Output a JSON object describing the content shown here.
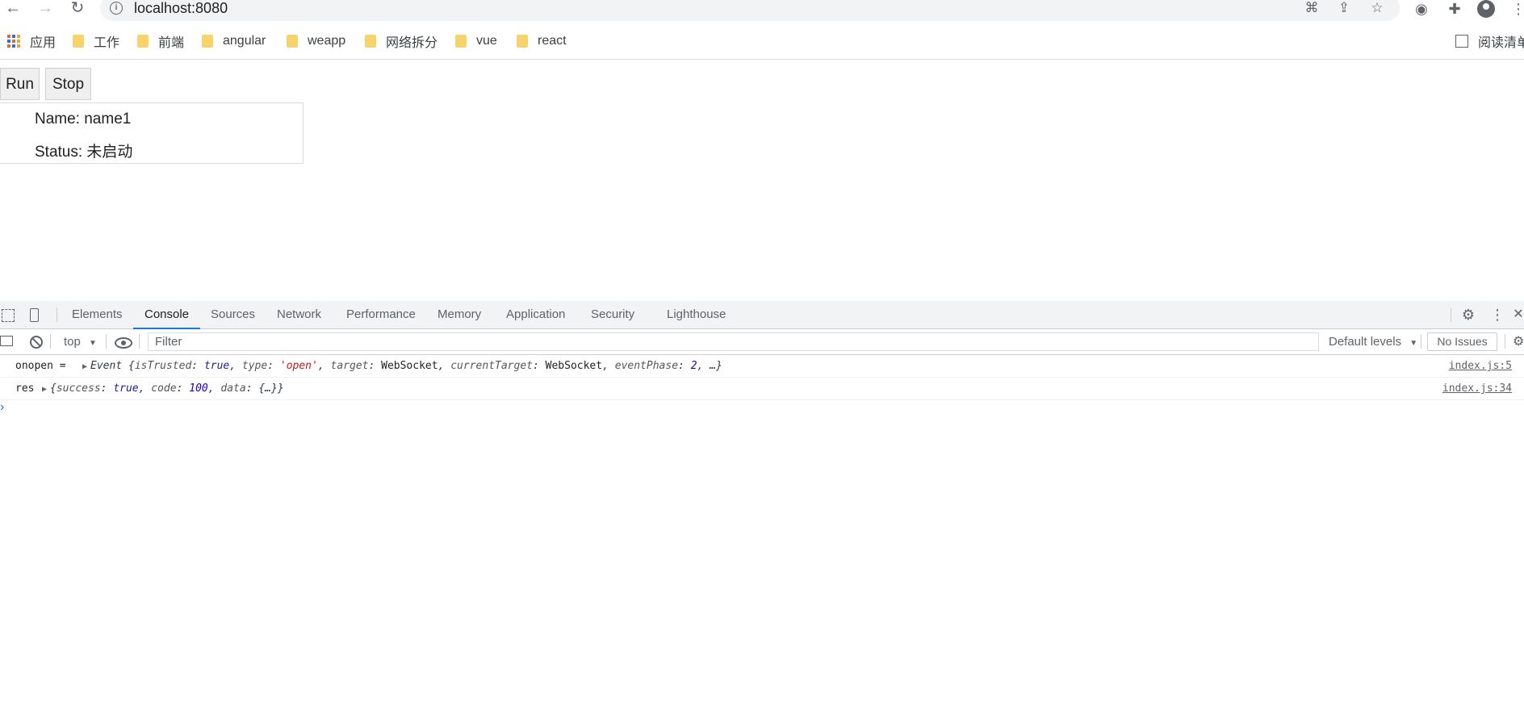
{
  "browser": {
    "url": "localhost:8080",
    "bookmarks": [
      {
        "label": "应用",
        "icon": "apps-icon"
      },
      {
        "label": "工作",
        "icon": "folder-icon"
      },
      {
        "label": "前端",
        "icon": "folder-icon"
      },
      {
        "label": "angular",
        "icon": "folder-icon"
      },
      {
        "label": "weapp",
        "icon": "folder-icon"
      },
      {
        "label": "网络拆分",
        "icon": "folder-icon"
      },
      {
        "label": "vue",
        "icon": "folder-icon"
      },
      {
        "label": "react",
        "icon": "folder-icon"
      }
    ],
    "reading_list": "阅读清单"
  },
  "page": {
    "run_label": "Run",
    "stop_label": "Stop",
    "name_line": "Name: name1",
    "status_line": "Status: 未启动"
  },
  "devtools": {
    "tabs": [
      "Elements",
      "Console",
      "Sources",
      "Network",
      "Performance",
      "Memory",
      "Application",
      "Security",
      "Lighthouse"
    ],
    "active_tab": "Console",
    "context": "top",
    "filter_placeholder": "Filter",
    "levels": "Default levels",
    "issues": "No Issues",
    "console": [
      {
        "label": "onopen =",
        "class_name": "Event",
        "entries": [
          {
            "key": "isTrusted",
            "value": "true",
            "type": "bool"
          },
          {
            "key": "type",
            "value": "'open'",
            "type": "string"
          },
          {
            "key": "target",
            "value": "WebSocket",
            "type": "obj"
          },
          {
            "key": "currentTarget",
            "value": "WebSocket",
            "type": "obj"
          },
          {
            "key": "eventPhase",
            "value": "2",
            "type": "num"
          }
        ],
        "tail": "…}",
        "source": "index.js:5"
      },
      {
        "label": "res",
        "class_name": "",
        "entries": [
          {
            "key": "success",
            "value": "true",
            "type": "bool"
          },
          {
            "key": "code",
            "value": "100",
            "type": "num"
          },
          {
            "key": "data",
            "value": "{…}",
            "type": "obj"
          }
        ],
        "tail": "}",
        "source": "index.js:34"
      }
    ],
    "prompt": "›"
  }
}
